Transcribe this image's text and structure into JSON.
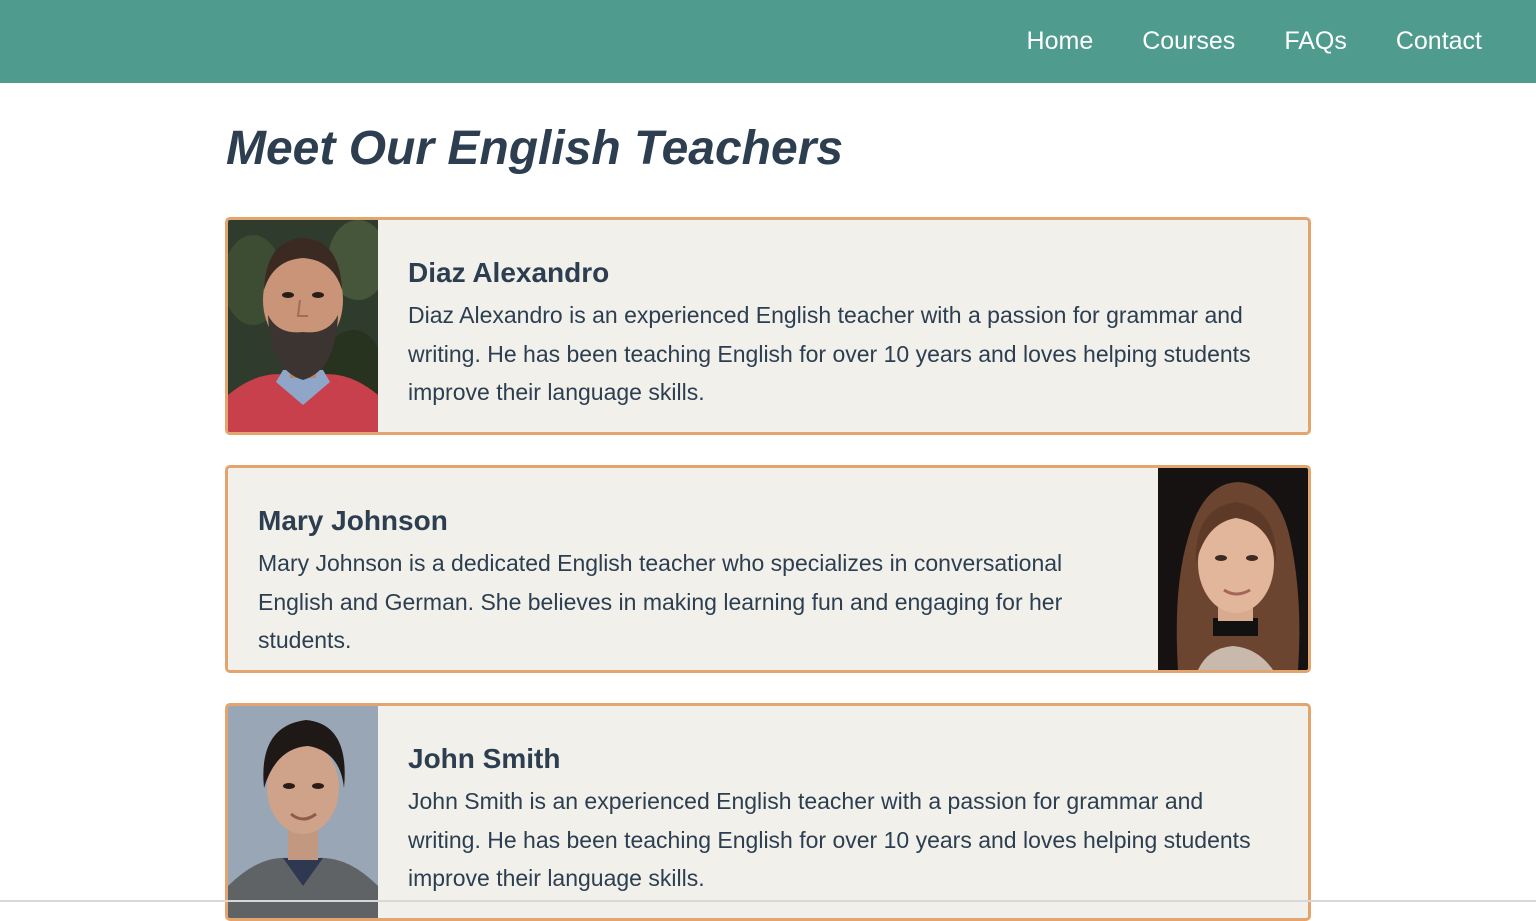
{
  "nav": {
    "items": [
      {
        "label": "Home"
      },
      {
        "label": "Courses"
      },
      {
        "label": "FAQs"
      },
      {
        "label": "Contact"
      }
    ]
  },
  "page": {
    "title": "Meet Our English Teachers"
  },
  "teachers": [
    {
      "name": "Diaz Alexandro",
      "bio": "Diaz Alexandro is an experienced English teacher with a passion for grammar and writing. He has been teaching English for over 10 years and loves helping students improve their language skills."
    },
    {
      "name": "Mary Johnson",
      "bio": "Mary Johnson is a dedicated English teacher who specializes in conversational English and German. She believes in making learning fun and engaging for her students."
    },
    {
      "name": "John Smith",
      "bio": "John Smith is an experienced English teacher with a passion for grammar and writing. He has been teaching English for over 10 years and loves helping students improve their language skills."
    }
  ],
  "colors": {
    "navbar": "#4f9b8e",
    "heading_text": "#2c3e50",
    "card_background": "#f1f0eb",
    "card_border": "#e3a46d"
  }
}
